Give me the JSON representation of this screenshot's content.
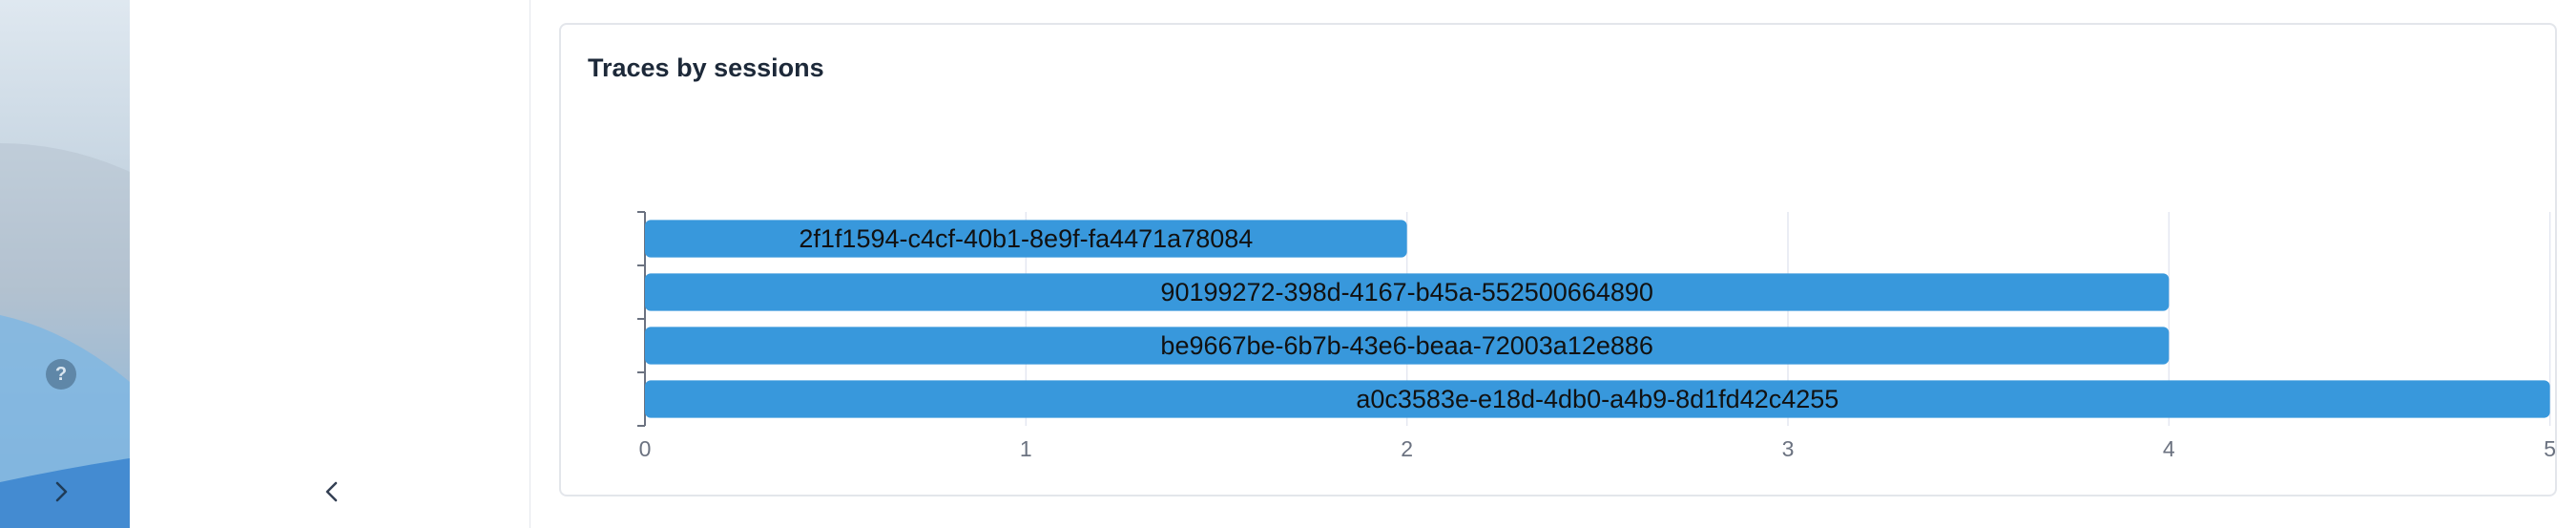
{
  "help": {
    "glyph": "?"
  },
  "card": {
    "title": "Traces by sessions"
  },
  "chart_data": {
    "type": "bar",
    "orientation": "horizontal",
    "title": "Traces by sessions",
    "xlabel": "",
    "ylabel": "",
    "categories": [
      "2f1f1594-c4cf-40b1-8e9f-fa4471a78084",
      "90199272-398d-4167-b45a-552500664890",
      "be9667be-6b7b-43e6-beaa-72003a12e886",
      "a0c3583e-e18d-4db0-a4b9-8d1fd42c4255"
    ],
    "values": [
      2,
      4,
      4,
      5
    ],
    "xlim": [
      0,
      6
    ],
    "xticks": [
      "0",
      "1",
      "2",
      "3",
      "4",
      "5",
      "6"
    ],
    "grid": true,
    "colors": {
      "bar": "#3898dc",
      "grid": "#e4e7f1",
      "axis": "#6b7280",
      "tick_label": "#6b7280",
      "bar_label": "#111111"
    }
  }
}
